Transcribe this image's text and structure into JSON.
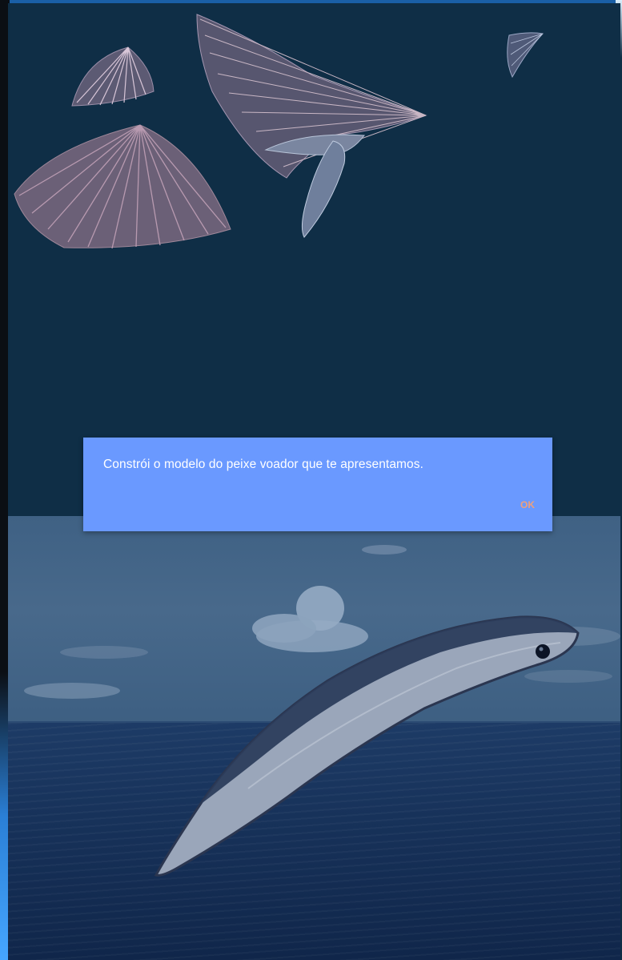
{
  "dialog": {
    "message": "Constrói o modelo do peixe voador que te apresentamos.",
    "ok_label": "OK"
  },
  "icons": {
    "fin_pieces": [
      "pectoral-fin-left",
      "dorsal-fin-top",
      "tail-fin-large",
      "pelvic-fin",
      "small-fin-top-right",
      "fin-piece-large-left"
    ],
    "fish_body": "flying-fish-body"
  },
  "colors": {
    "top_background": "#0f2e46",
    "dialog_background": "#6a99ff",
    "dialog_text": "#ffffff",
    "ok_text": "#f0a07a"
  }
}
